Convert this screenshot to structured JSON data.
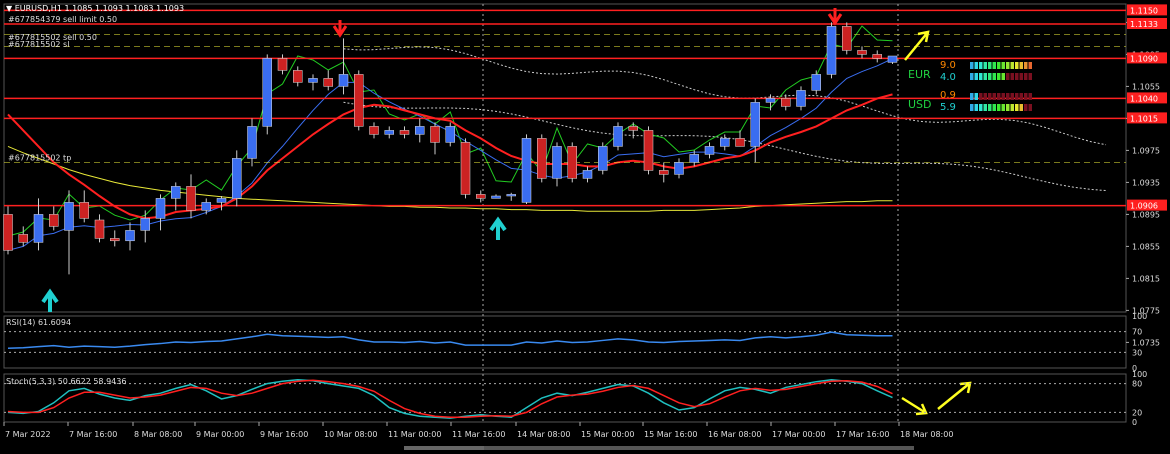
{
  "chart_data": {
    "type": "candlestick",
    "title": "EURUSD,H1  1.1085 1.1093 1.1083 1.1093",
    "symbol_marker": "▼",
    "colors": {
      "background": "#000000",
      "bull": "#3a6df0",
      "bear": "#cc2222",
      "wick": "#cccccc",
      "level": "#ff2020",
      "grid": "#333333",
      "sma_yellow": "#e8e838",
      "ema_red": "#ff2020",
      "green": "#22cc22",
      "blue_line": "#3a6df0",
      "cloud": "#cccccc",
      "arrow_red": "#ff2020",
      "arrow_cyan": "#20d0d0",
      "arrow_yellow": "#ffff20"
    },
    "y_ticks": [
      "1.1135",
      "1.1095",
      "1.1055",
      "1.1015",
      "1.0975",
      "1.0935",
      "1.0895",
      "1.0855",
      "1.0815",
      "1.0775",
      "1.0735"
    ],
    "ylim": [
      1.0773,
      1.1158
    ],
    "price_labels": [
      {
        "text": "1.1150",
        "value": 1.115
      },
      {
        "text": "1.1133",
        "value": 1.1133
      },
      {
        "text": "1.1090",
        "value": 1.109
      },
      {
        "text": "1.1040",
        "value": 1.104
      },
      {
        "text": "1.1015",
        "value": 1.1015
      },
      {
        "text": "1.0906",
        "value": 1.0906
      }
    ],
    "level_lines": [
      1.115,
      1.1133,
      1.109,
      1.104,
      1.1015,
      1.0906
    ],
    "dashed_levels": [
      1.112,
      1.1105,
      1.096
    ],
    "order_labels": [
      {
        "text": "#677854379 sell limit 0.50",
        "value": 1.1133
      },
      {
        "text": "#677815502 sell 0.50",
        "value": 1.1112
      },
      {
        "text": "#677815502 sl",
        "value": 1.1102
      },
      {
        "text": "#677815502 tp",
        "value": 1.096
      }
    ],
    "x_labels": [
      "7 Mar 2022",
      "7 Mar 16:00",
      "8 Mar 08:00",
      "9 Mar 00:00",
      "9 Mar 16:00",
      "10 Mar 08:00",
      "11 Mar 00:00",
      "11 Mar 16:00",
      "14 Mar 08:00",
      "15 Mar 00:00",
      "15 Mar 16:00",
      "16 Mar 08:00",
      "17 Mar 00:00",
      "17 Mar 16:00",
      "18 Mar 08:00"
    ],
    "candles": [
      [
        1.0895,
        1.0905,
        1.0845,
        1.085
      ],
      [
        1.087,
        1.088,
        1.0855,
        1.086
      ],
      [
        1.086,
        1.0915,
        1.085,
        1.0895
      ],
      [
        1.0895,
        1.0905,
        1.0875,
        1.088
      ],
      [
        1.0875,
        1.0925,
        1.082,
        1.091
      ],
      [
        1.091,
        1.0925,
        1.0885,
        1.089
      ],
      [
        1.0888,
        1.0895,
        1.086,
        1.0865
      ],
      [
        1.0865,
        1.0875,
        1.0855,
        1.0862
      ],
      [
        1.0862,
        1.0885,
        1.085,
        1.0875
      ],
      [
        1.0875,
        1.09,
        1.086,
        1.089
      ],
      [
        1.089,
        1.092,
        1.0875,
        1.0915
      ],
      [
        1.0915,
        1.0935,
        1.09,
        1.093
      ],
      [
        1.093,
        1.0945,
        1.089,
        1.09
      ],
      [
        1.09,
        1.0915,
        1.0895,
        1.091
      ],
      [
        1.091,
        1.0918,
        1.09,
        1.0915
      ],
      [
        1.0915,
        1.0975,
        1.0905,
        1.0965
      ],
      [
        1.0965,
        1.1015,
        1.0955,
        1.1005
      ],
      [
        1.1005,
        1.1095,
        1.0995,
        1.109
      ],
      [
        1.109,
        1.1095,
        1.107,
        1.1075
      ],
      [
        1.1075,
        1.108,
        1.1055,
        1.106
      ],
      [
        1.106,
        1.107,
        1.105,
        1.1065
      ],
      [
        1.1065,
        1.1075,
        1.105,
        1.1055
      ],
      [
        1.1055,
        1.1115,
        1.1045,
        1.107
      ],
      [
        1.107,
        1.1075,
        1.1,
        1.1005
      ],
      [
        1.1005,
        1.101,
        1.099,
        1.0995
      ],
      [
        1.0995,
        1.1005,
        1.099,
        1.1
      ],
      [
        1.1,
        1.1005,
        1.099,
        1.0995
      ],
      [
        1.0995,
        1.1015,
        1.0985,
        1.1005
      ],
      [
        1.1005,
        1.101,
        1.097,
        1.0985
      ],
      [
        1.0985,
        1.101,
        1.098,
        1.1005
      ],
      [
        1.0985,
        1.099,
        1.0915,
        1.092
      ],
      [
        1.092,
        1.0925,
        1.091,
        1.0915
      ],
      [
        1.0915,
        1.092,
        1.0915,
        1.0918
      ],
      [
        1.0918,
        1.0922,
        1.0912,
        1.092
      ],
      [
        1.091,
        1.0995,
        1.0908,
        1.099
      ],
      [
        1.099,
        1.0995,
        1.0935,
        1.094
      ],
      [
        1.094,
        1.0985,
        1.093,
        1.098
      ],
      [
        1.098,
        1.0985,
        1.0935,
        1.094
      ],
      [
        1.094,
        1.0955,
        1.0935,
        1.095
      ],
      [
        1.095,
        1.0985,
        1.0945,
        1.098
      ],
      [
        1.098,
        1.101,
        1.0975,
        1.1005
      ],
      [
        1.1005,
        1.101,
        1.099,
        1.1
      ],
      [
        1.1,
        1.1005,
        1.0945,
        1.095
      ],
      [
        1.095,
        1.096,
        1.0935,
        1.0945
      ],
      [
        1.0945,
        1.0965,
        1.094,
        1.096
      ],
      [
        1.096,
        1.0975,
        1.0955,
        1.097
      ],
      [
        1.097,
        1.0985,
        1.0965,
        1.098
      ],
      [
        1.098,
        1.0995,
        1.0975,
        1.099
      ],
      [
        1.099,
        1.1,
        1.098,
        1.098
      ],
      [
        1.098,
        1.104,
        1.096,
        1.1035
      ],
      [
        1.1035,
        1.1045,
        1.1025,
        1.104
      ],
      [
        1.104,
        1.1045,
        1.1025,
        1.103
      ],
      [
        1.103,
        1.1055,
        1.1025,
        1.105
      ],
      [
        1.105,
        1.1075,
        1.1045,
        1.107
      ],
      [
        1.107,
        1.1135,
        1.1065,
        1.113
      ],
      [
        1.113,
        1.1135,
        1.1095,
        1.11
      ],
      [
        1.11,
        1.1105,
        1.109,
        1.1095
      ],
      [
        1.1095,
        1.11,
        1.1085,
        1.109
      ],
      [
        1.1085,
        1.1093,
        1.1083,
        1.1093
      ]
    ],
    "sma_yellow": [
      1.098,
      1.0972,
      1.0965,
      1.0958,
      1.0951,
      1.0945,
      1.094,
      1.0935,
      1.0931,
      1.0928,
      1.0925,
      1.0923,
      1.0921,
      1.0919,
      1.0917,
      1.0915,
      1.0914,
      1.0913,
      1.0912,
      1.0911,
      1.091,
      1.0909,
      1.0908,
      1.0907,
      1.0906,
      1.0905,
      1.0905,
      1.0904,
      1.0904,
      1.0903,
      1.0903,
      1.0902,
      1.0902,
      1.0901,
      1.0901,
      1.09,
      1.09,
      1.09,
      1.0899,
      1.0899,
      1.0899,
      1.0899,
      1.0899,
      1.09,
      1.09,
      1.09,
      1.0901,
      1.0902,
      1.0903,
      1.0905,
      1.0906,
      1.0907,
      1.0908,
      1.0909,
      1.091,
      1.0911,
      1.0911,
      1.0912,
      1.0912
    ],
    "ema_red": [
      1.102,
      1.1,
      1.098,
      1.096,
      1.0945,
      1.0932,
      1.0918,
      1.0905,
      1.0895,
      1.089,
      1.0892,
      1.0898,
      1.09,
      1.0902,
      1.0905,
      1.0915,
      1.093,
      1.095,
      1.0965,
      1.098,
      1.0995,
      1.1008,
      1.102,
      1.1028,
      1.1032,
      1.103,
      1.1025,
      1.102,
      1.1015,
      1.1012,
      1.1,
      1.099,
      1.0978,
      1.0968,
      1.0962,
      1.0958,
      1.0958,
      1.0958,
      1.0955,
      1.0955,
      1.096,
      1.0962,
      1.096,
      1.0955,
      1.0952,
      1.0955,
      1.096,
      1.0965,
      1.0968,
      1.0975,
      1.0985,
      1.0992,
      1.0998,
      1.1005,
      1.1015,
      1.1025,
      1.1032,
      1.104,
      1.1045
    ],
    "rsi": {
      "label": "RSI(14) 61.6094",
      "value": 61.6094,
      "levels": [
        30,
        70
      ],
      "ticks": [
        "100",
        "70",
        "30",
        "0"
      ],
      "values": [
        38,
        39,
        41,
        43,
        40,
        42,
        41,
        40,
        42,
        45,
        47,
        50,
        49,
        51,
        52,
        56,
        60,
        65,
        62,
        61,
        60,
        59,
        60,
        54,
        50,
        50,
        49,
        51,
        48,
        50,
        44,
        44,
        44,
        44,
        50,
        48,
        52,
        49,
        50,
        53,
        56,
        54,
        50,
        49,
        51,
        52,
        53,
        54,
        53,
        58,
        60,
        58,
        60,
        63,
        69,
        64,
        63,
        62,
        62
      ]
    },
    "stoch": {
      "label": "Stoch(5,3,3) 50.6622 58.9436",
      "k": 50.6622,
      "d": 58.9436,
      "levels": [
        20,
        80
      ],
      "ticks": [
        "100",
        "80",
        "20",
        "0"
      ],
      "k_values": [
        20,
        18,
        22,
        40,
        65,
        70,
        58,
        50,
        45,
        55,
        60,
        70,
        78,
        65,
        48,
        55,
        68,
        80,
        85,
        88,
        86,
        80,
        75,
        70,
        55,
        30,
        18,
        12,
        10,
        8,
        12,
        15,
        12,
        10,
        30,
        50,
        60,
        55,
        62,
        70,
        78,
        75,
        60,
        40,
        25,
        30,
        48,
        65,
        72,
        68,
        60,
        72,
        78,
        84,
        88,
        85,
        80,
        65,
        51
      ],
      "d_values": [
        22,
        20,
        20,
        30,
        50,
        62,
        62,
        56,
        50,
        52,
        56,
        64,
        72,
        70,
        60,
        55,
        60,
        70,
        80,
        85,
        87,
        84,
        80,
        74,
        64,
        45,
        28,
        18,
        12,
        10,
        10,
        12,
        13,
        12,
        20,
        38,
        52,
        56,
        58,
        64,
        72,
        76,
        70,
        55,
        40,
        32,
        38,
        52,
        65,
        70,
        66,
        68,
        74,
        80,
        85,
        86,
        83,
        74,
        59
      ]
    }
  },
  "legend": {
    "eur": {
      "label": "EUR",
      "value_top": "9.0",
      "value": "4.0",
      "value_top_color": "#ff8800",
      "value_color": "#20d0d0"
    },
    "usd": {
      "label": "USD",
      "value_top": "0.9",
      "value": "5.9",
      "value_top_color": "#ff8800",
      "value_color": "#20d0d0"
    }
  }
}
